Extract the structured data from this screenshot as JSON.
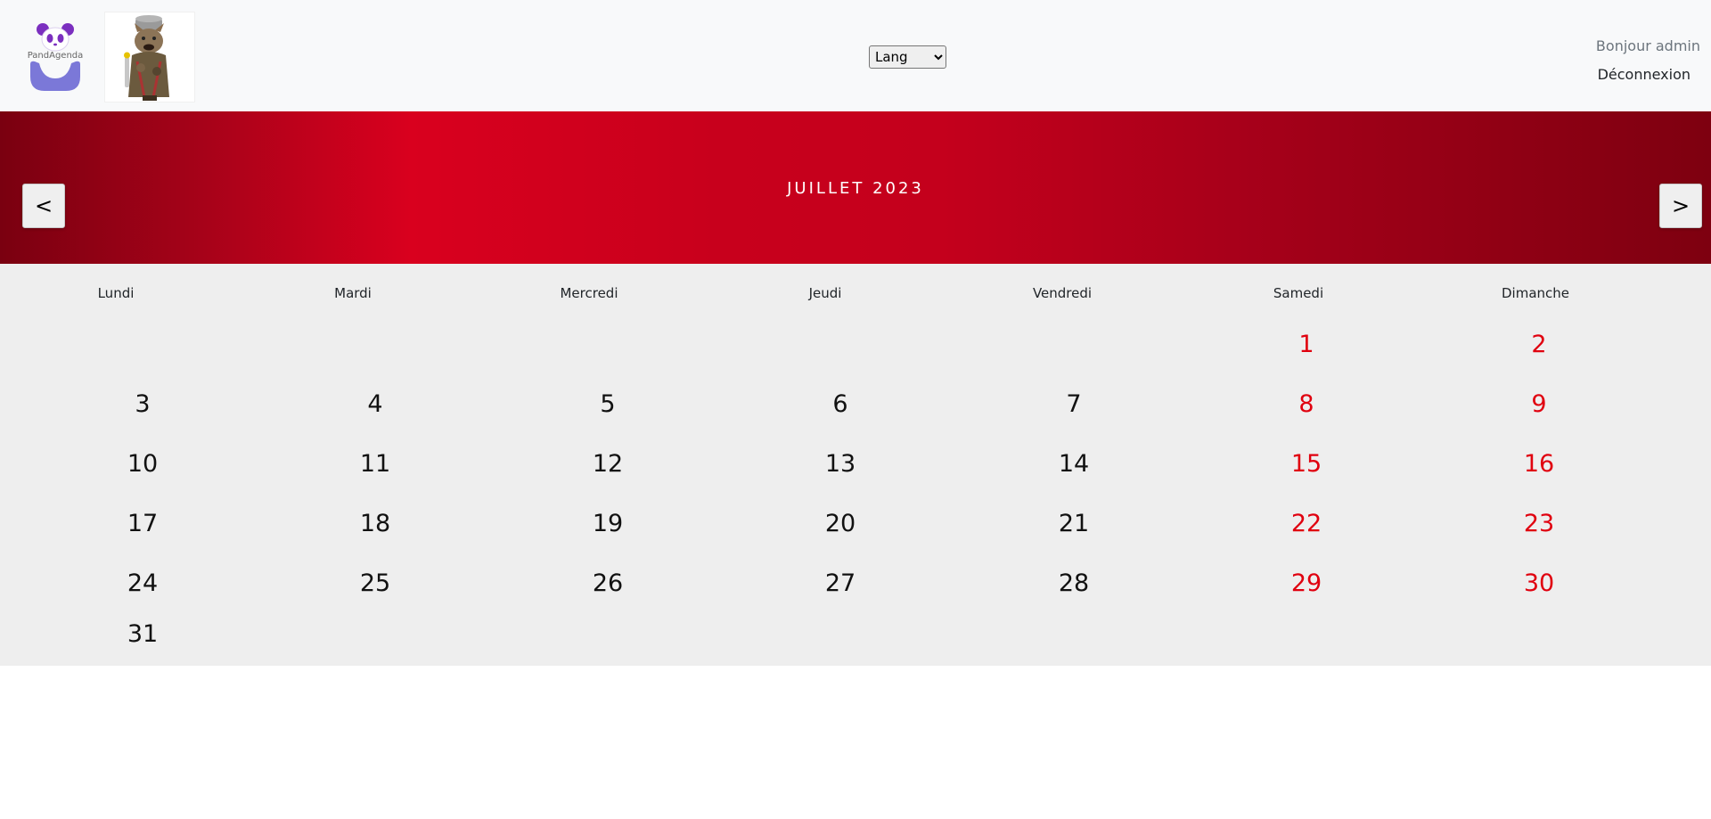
{
  "header": {
    "logo_text": "PandAgenda",
    "language_select": {
      "selected": "Lang",
      "options": [
        "Lang"
      ]
    },
    "greeting": "Bonjour admin",
    "logout_label": "Déconnexion"
  },
  "calendar": {
    "month_title": "JUILLET 2023",
    "prev_label": "<",
    "next_label": ">",
    "weekdays": [
      "Lundi",
      "Mardi",
      "Mercredi",
      "Jeudi",
      "Vendredi",
      "Samedi",
      "Dimanche"
    ],
    "weeks": [
      [
        "",
        "",
        "",
        "",
        "",
        "1",
        "2"
      ],
      [
        "3",
        "4",
        "5",
        "6",
        "7",
        "8",
        "9"
      ],
      [
        "10",
        "11",
        "12",
        "13",
        "14",
        "15",
        "16"
      ],
      [
        "17",
        "18",
        "19",
        "20",
        "21",
        "22",
        "23"
      ],
      [
        "24",
        "25",
        "26",
        "27",
        "28",
        "29",
        "30"
      ],
      [
        "31",
        "",
        "",
        "",
        "",
        "",
        ""
      ]
    ],
    "weekend_color": "#e0000f",
    "weekday_color": "#111111",
    "accent_color": "#d9001e"
  }
}
